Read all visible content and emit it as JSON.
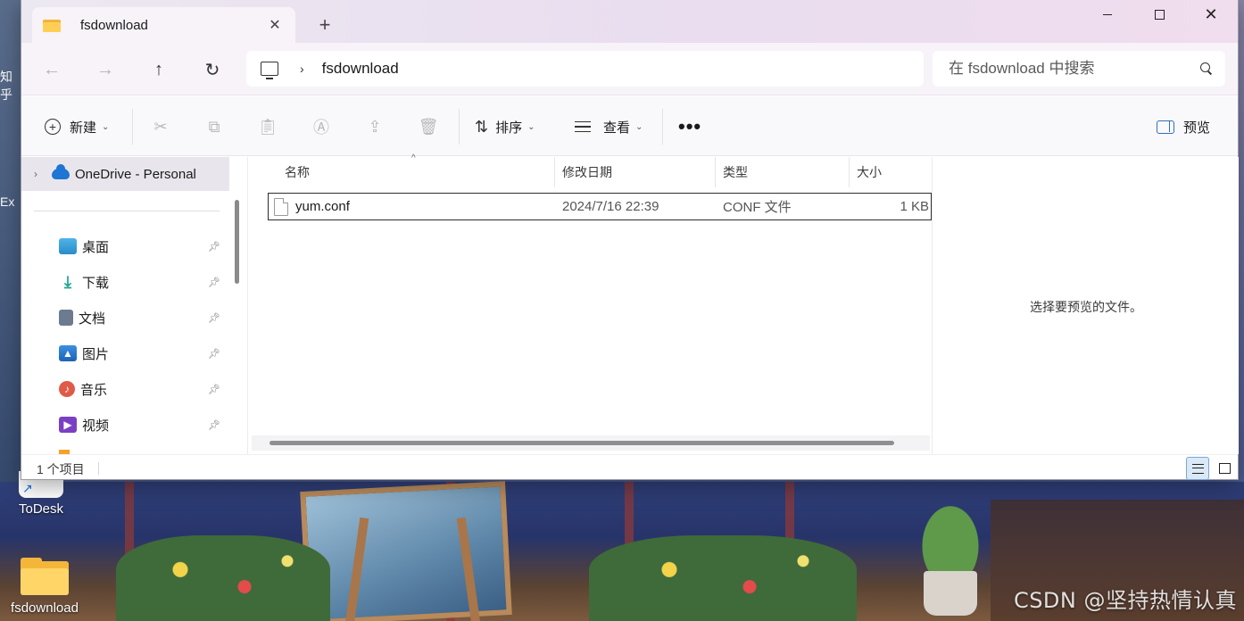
{
  "window": {
    "tab_title": "fsdownload",
    "tab_close_glyph": "✕",
    "new_tab_glyph": "+"
  },
  "nav": {
    "back_glyph": "←",
    "forward_glyph": "→",
    "up_glyph": "↑",
    "refresh_glyph": "↻",
    "breadcrumb": "fsdownload",
    "search_placeholder": "在 fsdownload 中搜索"
  },
  "toolbar": {
    "new_label": "新建",
    "sort_label": "排序",
    "view_label": "查看",
    "more_label": "•••",
    "preview_label": "预览",
    "icons": [
      "cut-icon",
      "copy-icon",
      "paste-icon",
      "rename-icon",
      "share-icon",
      "delete-icon"
    ]
  },
  "sidebar": {
    "onedrive_label": "OneDrive - Personal",
    "items": [
      {
        "label": "桌面",
        "icon": "desktop-icon"
      },
      {
        "label": "下载",
        "icon": "download-icon"
      },
      {
        "label": "文档",
        "icon": "documents-icon"
      },
      {
        "label": "图片",
        "icon": "pictures-icon"
      },
      {
        "label": "音乐",
        "icon": "music-icon"
      },
      {
        "label": "视频",
        "icon": "videos-icon"
      }
    ]
  },
  "filelist": {
    "columns": [
      "名称",
      "修改日期",
      "类型",
      "大小"
    ],
    "rows": [
      {
        "name": "yum.conf",
        "modified": "2024/7/16 22:39",
        "type": "CONF 文件",
        "size": "1 KB"
      }
    ]
  },
  "preview": {
    "empty_message": "选择要预览的文件。"
  },
  "status": {
    "item_count": "1 个项目"
  },
  "desktop": {
    "icons": [
      {
        "label": "ToDesk"
      },
      {
        "label": "fsdownload"
      }
    ],
    "watermark": "CSDN @坚持热情认真",
    "left_strip_labels": [
      "知乎",
      "Ex"
    ]
  },
  "colors": {
    "title_gradient_start": "#ece8f1",
    "title_gradient_end": "#f0dded",
    "accent": "#2f6fb8",
    "folder": "#f4b63a"
  }
}
